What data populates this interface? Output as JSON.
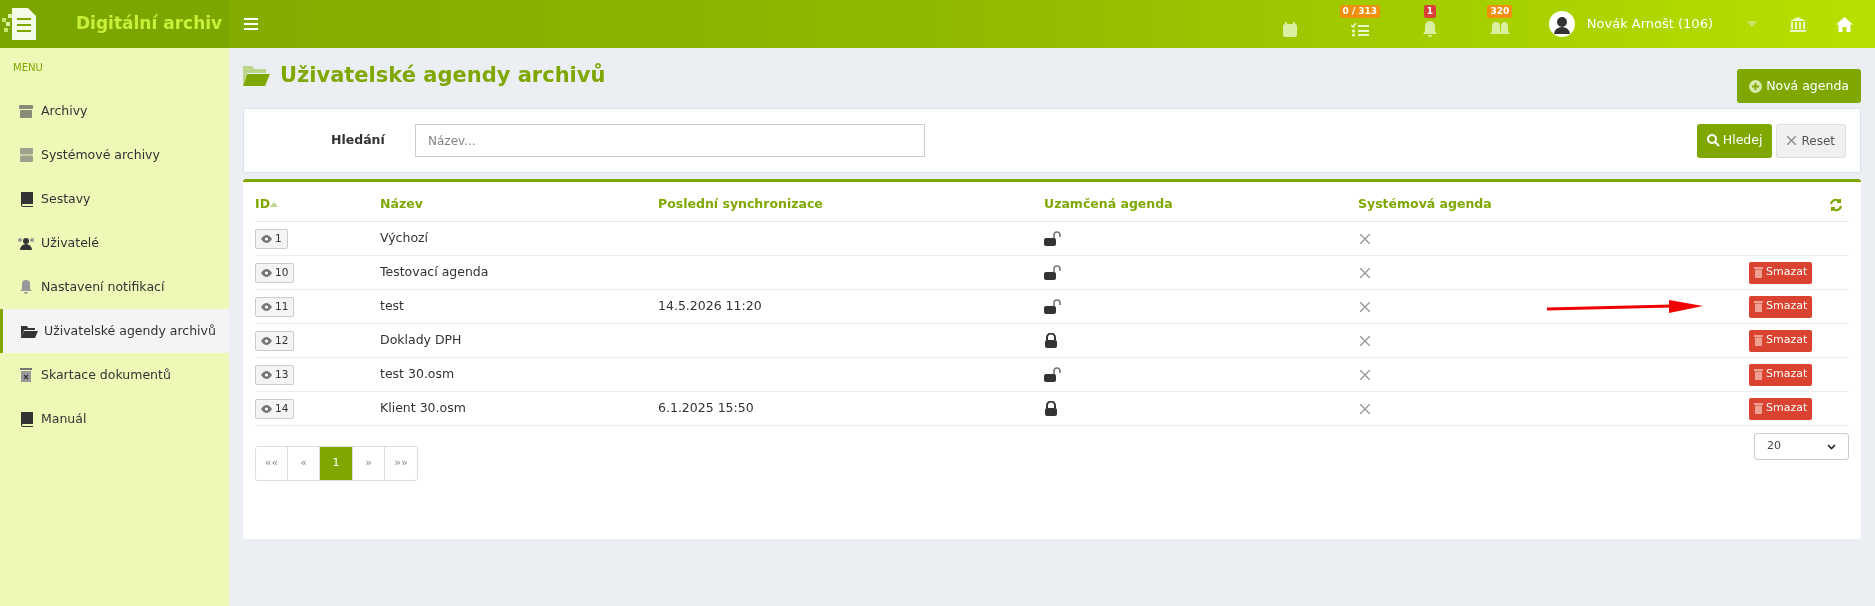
{
  "app": {
    "title": "Digitální archiv"
  },
  "topbar": {
    "badges": [
      {
        "kind": "calendar"
      },
      {
        "kind": "tasks",
        "count": "0 / 313",
        "color": "#f0900c"
      },
      {
        "kind": "bell",
        "count": "1",
        "color": "#d9403a"
      },
      {
        "kind": "bells",
        "count": "320",
        "color": "#f0900c"
      }
    ],
    "user": "Novák Arnošt (106)"
  },
  "sidebar": {
    "heading": "MENU",
    "items": [
      {
        "label": "Archivy",
        "selected": false
      },
      {
        "label": "Systémové archivy",
        "selected": false
      },
      {
        "label": "Sestavy",
        "selected": false
      },
      {
        "label": "Uživatelé",
        "selected": false
      },
      {
        "label": "Nastavení notifikací",
        "selected": false
      },
      {
        "label": "Uživatelské agendy archivů",
        "selected": true
      },
      {
        "label": "Skartace dokumentů",
        "selected": false
      },
      {
        "label": "Manuál",
        "selected": false
      }
    ]
  },
  "page": {
    "title": "Uživatelské agendy archivů",
    "new_button": "Nová agenda"
  },
  "search": {
    "label": "Hledání",
    "placeholder": "Název...",
    "search_button": "Hledej",
    "reset_button": "Reset"
  },
  "table": {
    "columns": [
      "ID",
      "Název",
      "Poslední synchronizace",
      "Uzamčená agenda",
      "Systémová agenda"
    ],
    "rows": [
      {
        "id": "1",
        "name": "Výchozí",
        "sync": "",
        "locked": false,
        "system": false,
        "delete": null,
        "arrow": false
      },
      {
        "id": "10",
        "name": "Testovací agenda",
        "sync": "",
        "locked": false,
        "system": false,
        "delete": "Smazat",
        "arrow": false
      },
      {
        "id": "11",
        "name": "test",
        "sync": "14.5.2026 11:20",
        "locked": false,
        "system": false,
        "delete": "Smazat",
        "arrow": true
      },
      {
        "id": "12",
        "name": "Doklady DPH",
        "sync": "",
        "locked": true,
        "system": false,
        "delete": "Smazat",
        "arrow": false
      },
      {
        "id": "13",
        "name": "test 30.osm",
        "sync": "",
        "locked": false,
        "system": false,
        "delete": "Smazat",
        "arrow": false
      },
      {
        "id": "14",
        "name": "Klient 30.osm",
        "sync": "6.1.2025 15:50",
        "locked": true,
        "system": false,
        "delete": "Smazat",
        "arrow": false
      }
    ]
  },
  "pagination": {
    "pages": [
      {
        "label": "««",
        "selected": false
      },
      {
        "label": "«",
        "selected": false
      },
      {
        "label": "1",
        "selected": true
      },
      {
        "label": "»",
        "selected": false
      },
      {
        "label": "»»",
        "selected": false
      }
    ],
    "page_size": "20"
  }
}
